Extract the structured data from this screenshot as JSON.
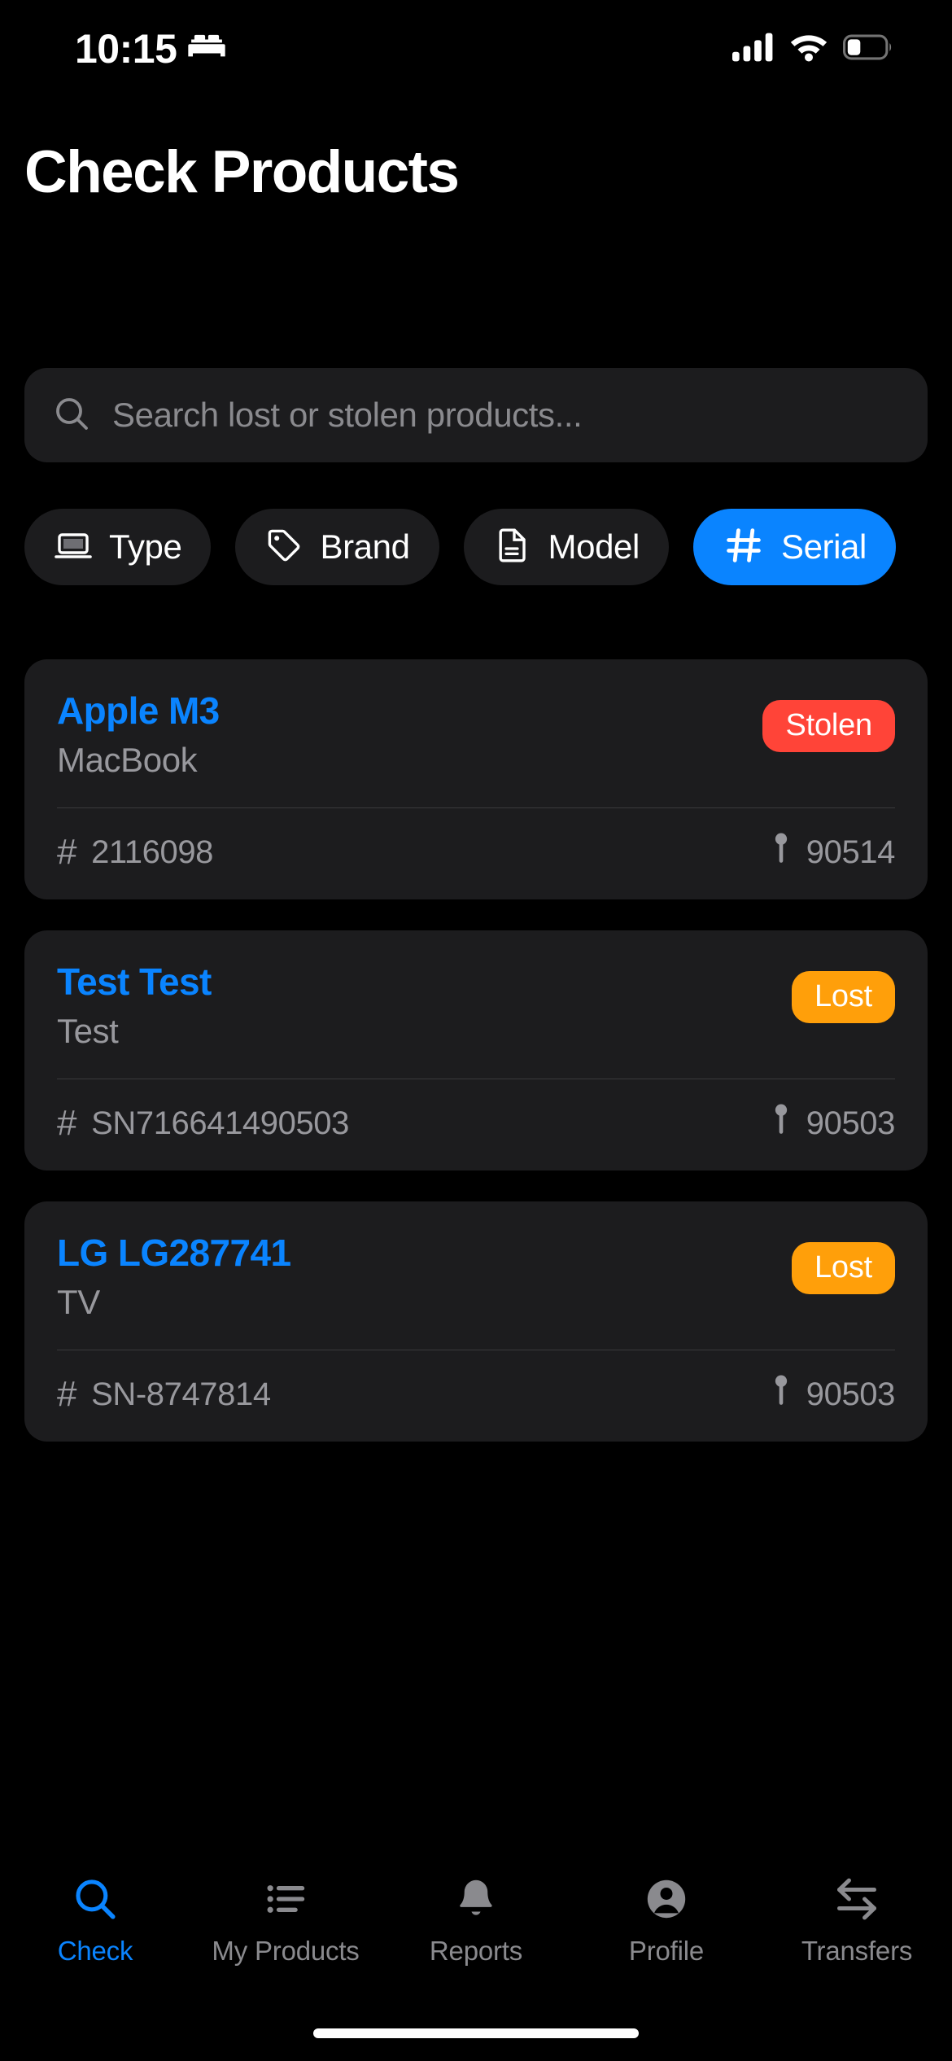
{
  "status_bar": {
    "time": "10:15",
    "focus_icon": "bed-icon",
    "cellular_icon": "cellular-signal-icon",
    "wifi_icon": "wifi-icon",
    "battery_icon": "battery-icon",
    "battery_level_pct": 30
  },
  "header": {
    "title": "Check Products"
  },
  "search": {
    "placeholder": "Search lost or stolen products...",
    "value": "",
    "icon": "search-icon"
  },
  "filters": {
    "chips": [
      {
        "label": "Type",
        "icon": "laptop-icon",
        "active": false
      },
      {
        "label": "Brand",
        "icon": "tag-icon",
        "active": false
      },
      {
        "label": "Model",
        "icon": "document-icon",
        "active": false
      },
      {
        "label": "Serial",
        "icon": "hash-icon",
        "active": true
      }
    ]
  },
  "products": [
    {
      "title": "Apple M3",
      "subtitle": "MacBook",
      "status": "Stolen",
      "status_color": "#FF4438",
      "serial": "2116098",
      "zip": "90514",
      "serial_icon": "hash-icon",
      "location_icon": "map-pin-icon"
    },
    {
      "title": "Test Test",
      "subtitle": "Test",
      "status": "Lost",
      "status_color": "#FF9F0A",
      "serial": "SN716641490503",
      "zip": "90503",
      "serial_icon": "hash-icon",
      "location_icon": "map-pin-icon"
    },
    {
      "title": "LG LG287741",
      "subtitle": "TV",
      "status": "Lost",
      "status_color": "#FF9F0A",
      "serial": "SN-8747814",
      "zip": "90503",
      "serial_icon": "hash-icon",
      "location_icon": "map-pin-icon"
    }
  ],
  "tabbar": {
    "items": [
      {
        "label": "Check",
        "icon": "search-icon",
        "active": true
      },
      {
        "label": "My Products",
        "icon": "list-icon",
        "active": false
      },
      {
        "label": "Reports",
        "icon": "bell-icon",
        "active": false
      },
      {
        "label": "Profile",
        "icon": "person-icon",
        "active": false
      },
      {
        "label": "Transfers",
        "icon": "transfer-arrows-icon",
        "active": false
      }
    ]
  },
  "colors": {
    "background": "#000000",
    "card": "#1C1C1E",
    "accent": "#0A84FF",
    "muted_text": "#98989D",
    "placeholder_text": "#8A8A8E"
  }
}
